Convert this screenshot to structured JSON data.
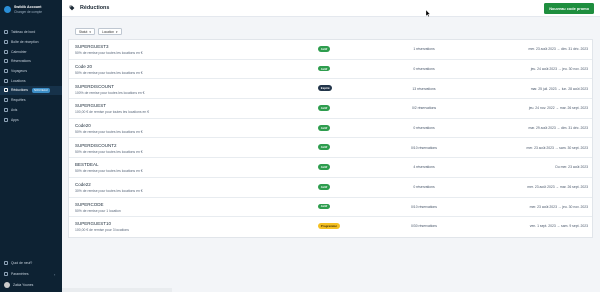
{
  "sidebar": {
    "account_name": "Swiklik Account",
    "account_switch": "Changer de compte",
    "items": [
      {
        "label": "Tableau de bord",
        "icon": "dashboard-icon",
        "active": false
      },
      {
        "label": "Boîte de réception",
        "icon": "inbox-icon",
        "active": false
      },
      {
        "label": "Calendrier",
        "icon": "calendar-icon",
        "active": false
      },
      {
        "label": "Réservations",
        "icon": "bookings-icon",
        "active": false
      },
      {
        "label": "Voyageurs",
        "icon": "travelers-icon",
        "active": false
      },
      {
        "label": "Locations",
        "icon": "home-icon",
        "active": false
      },
      {
        "label": "Réductions",
        "icon": "tag-icon",
        "active": true,
        "badge": "NOUVEAU"
      },
      {
        "label": "Requêtes",
        "icon": "requests-icon",
        "active": false
      },
      {
        "label": "Avis",
        "icon": "star-icon",
        "active": false
      },
      {
        "label": "Apps",
        "icon": "apps-icon",
        "active": false
      }
    ],
    "bottom_items": [
      {
        "label": "Quoi de neuf?",
        "icon": "gift-icon"
      },
      {
        "label": "Paramètres",
        "icon": "gear-icon"
      }
    ],
    "user_name": "Zakia Younes"
  },
  "header": {
    "title": "Réductions",
    "new_button_label": "Nouveau code promo"
  },
  "filters": {
    "status_label": "Statut",
    "location_label": "Location"
  },
  "colors": {
    "active": "#2e9d4e",
    "expired": "#22354a",
    "scheduled": "#f4c022",
    "primary_button": "#1e8e3e",
    "sidebar": "#0d2233"
  },
  "promos": [
    {
      "code": "SUPERGUEST3",
      "description": "50% de remise pour toutes les locations en €",
      "status": "Actif",
      "status_type": "active",
      "reservations": "1 réservations",
      "dates": "mer. 23 août 2023 → dim. 31 déc. 2023"
    },
    {
      "code": "Code 20",
      "description": "50% de remise pour toutes les locations en €",
      "status": "Actif",
      "status_type": "active",
      "reservations": "0 réservations",
      "dates": "jeu. 24 août 2023 → jeu. 30 nov. 2023"
    },
    {
      "code": "SUPERDISCOUNT",
      "description": "100% de remise pour toutes les locations en €",
      "status": "Expiré",
      "status_type": "expired",
      "reservations": "13 réservations",
      "dates": "mar. 25 juil. 2023 → lun. 28 août 2023"
    },
    {
      "code": "SUPERGUEST",
      "description": "100,00 € de remise pour toutes les locations en €",
      "status": "Actif",
      "status_type": "active",
      "reservations": "0/2 réservations",
      "dates": "jeu. 24 nov. 2022 → mar. 26 sept. 2023"
    },
    {
      "code": "Code20",
      "description": "50% de remise pour toutes les locations en €",
      "status": "Actif",
      "status_type": "active",
      "reservations": "0 réservations",
      "dates": "mar. 29 août 2023 → dim. 31 déc. 2023"
    },
    {
      "code": "SUPERDISCOUNT2",
      "description": "50% de remise pour toutes les locations en €",
      "status": "Actif",
      "status_type": "active",
      "reservations": "0/10 réservations",
      "dates": "mer. 23 août 2023 → sam. 30 sept. 2023"
    },
    {
      "code": "BESTDEAL",
      "description": "50% de remise pour toutes les locations en €",
      "status": "Actif",
      "status_type": "active",
      "reservations": "4 réservations",
      "dates": "Du mer. 23 août 2023"
    },
    {
      "code": "Code22",
      "description": "30% de remise pour toutes les locations en €",
      "status": "Actif",
      "status_type": "active",
      "reservations": "0 réservations",
      "dates": "mer. 23 août 2023 → mar. 26 sept. 2023"
    },
    {
      "code": "SUPERCODE",
      "description": "50% de remise pour 1 location",
      "status": "Actif",
      "status_type": "active",
      "reservations": "0/10 réservations",
      "dates": "mer. 23 août 2023 → jeu. 30 nov. 2023"
    },
    {
      "code": "SUPERGUEST10",
      "description": "100,00 € de remise pour 3 locations",
      "status": "Programmé",
      "status_type": "scheduled",
      "reservations": "0/30 réservations",
      "dates": "ven. 1 sept. 2023 → sam. 9 sept. 2023"
    }
  ]
}
